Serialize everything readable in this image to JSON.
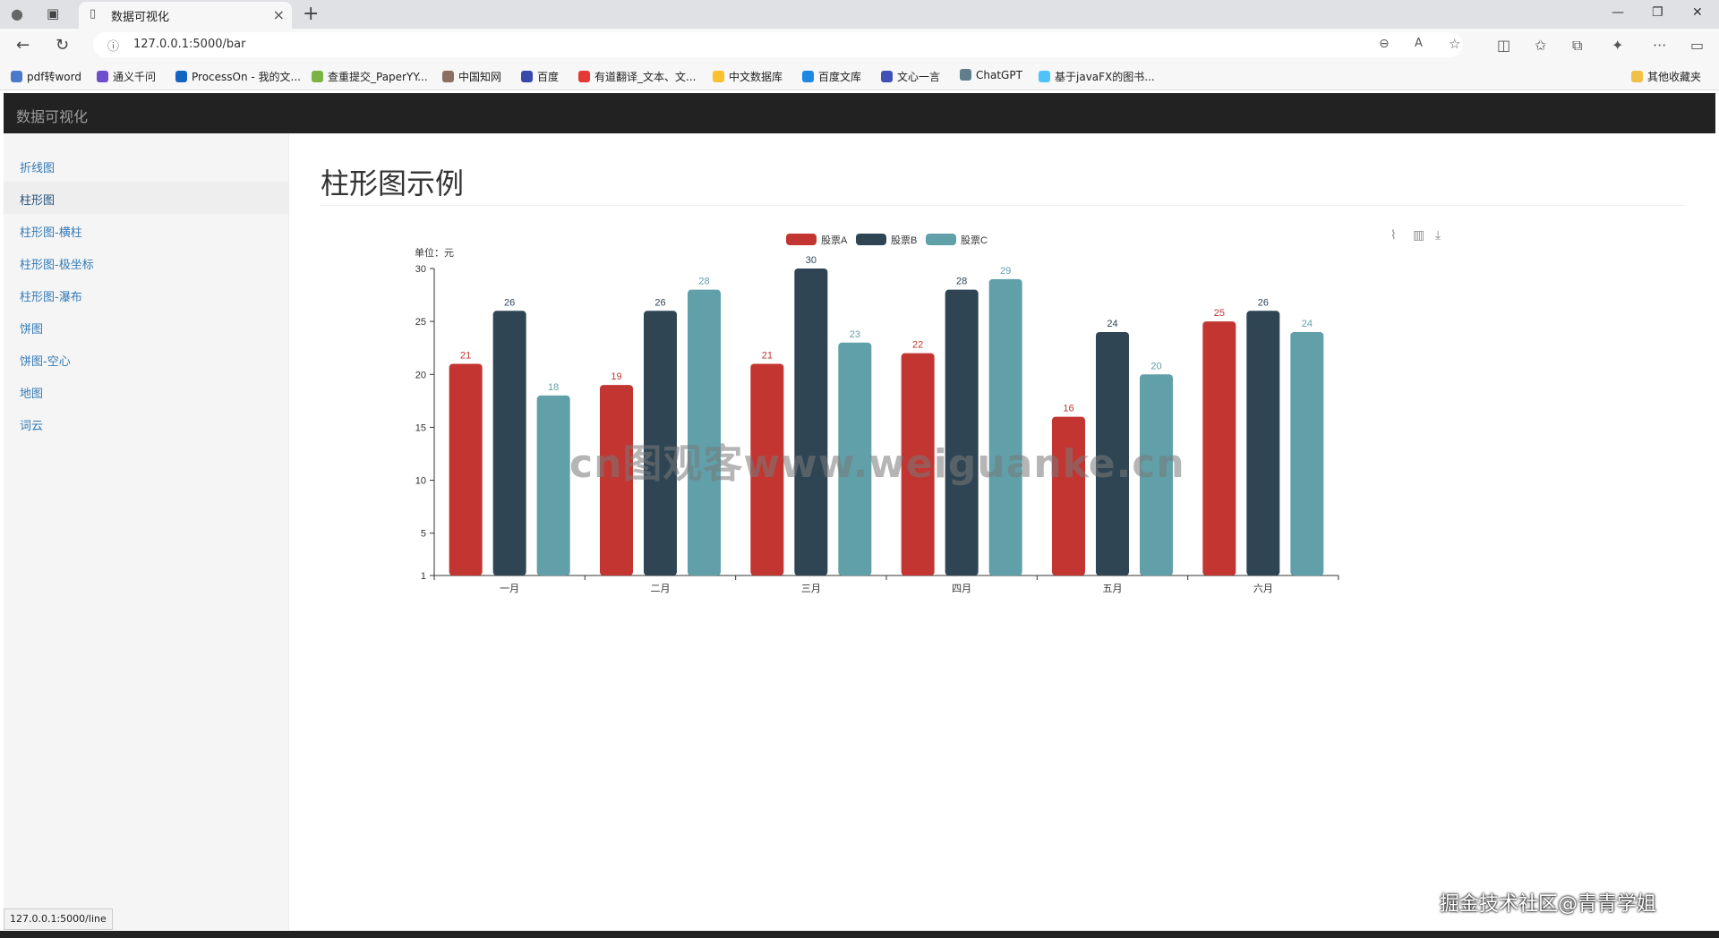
{
  "browser": {
    "tab_title": "数据可视化",
    "url": "127.0.0.1:5000/bar",
    "bookmarks": [
      "pdf转word",
      "通义千问",
      "ProcessOn - 我的文...",
      "查重提交_PaperYY...",
      "中国知网",
      "百度",
      "有道翻译_文本、文...",
      "中文数据库",
      "百度文库",
      "文心一言",
      "ChatGPT",
      "基于javaFX的图书..."
    ],
    "other_bookmarks": "其他收藏夹"
  },
  "navbar": {
    "brand": "数据可视化"
  },
  "sidebar": {
    "items": [
      {
        "label": "折线图"
      },
      {
        "label": "柱形图"
      },
      {
        "label": "柱形图-横柱"
      },
      {
        "label": "柱形图-极坐标"
      },
      {
        "label": "柱形图-瀑布"
      },
      {
        "label": "饼图"
      },
      {
        "label": "饼图-空心"
      },
      {
        "label": "地图"
      },
      {
        "label": "词云"
      }
    ],
    "active_index": 1
  },
  "main": {
    "title": "柱形图示例"
  },
  "chart_data": {
    "type": "bar",
    "categories": [
      "一月",
      "二月",
      "三月",
      "四月",
      "五月",
      "六月"
    ],
    "series": [
      {
        "name": "股票A",
        "color": "#c23531",
        "values": [
          21,
          19,
          21,
          22,
          16,
          25
        ]
      },
      {
        "name": "股票B",
        "color": "#2f4554",
        "values": [
          26,
          26,
          30,
          28,
          24,
          26
        ]
      },
      {
        "name": "股票C",
        "color": "#61a0a8",
        "values": [
          18,
          28,
          23,
          29,
          20,
          24
        ]
      }
    ],
    "ylabel": "单位：元",
    "yticks": [
      "1",
      "5",
      "10",
      "15",
      "20",
      "25",
      "30"
    ],
    "ylim": [
      1,
      30
    ],
    "legend_position": "top-center",
    "toolbox": [
      "line-chart-icon",
      "bar-chart-icon",
      "download-icon"
    ]
  },
  "status_link": "127.0.0.1:5000/line",
  "watermarks": [
    "cn图观客www.weiguanke.cn",
    "掘金技术社区@青青学姐"
  ]
}
